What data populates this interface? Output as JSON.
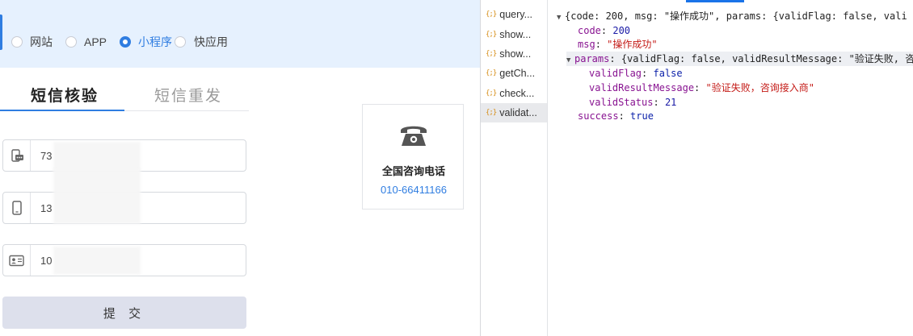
{
  "app": {
    "type_options": [
      {
        "label": "网站",
        "checked": false
      },
      {
        "label": "APP",
        "checked": false
      },
      {
        "label": "小程序",
        "checked": true
      },
      {
        "label": "快应用",
        "checked": false
      }
    ],
    "tabs": [
      {
        "label": "短信核验",
        "active": true
      },
      {
        "label": "短信重发",
        "active": false
      }
    ],
    "fields": {
      "code_value": "73",
      "phone_value": "13",
      "id_value": "10"
    },
    "submit_label": "提 交",
    "consult": {
      "title": "全国咨询电话",
      "phone": "010-66411166"
    }
  },
  "devtools": {
    "requests": [
      {
        "name": "query...",
        "selected": false
      },
      {
        "name": "show...",
        "selected": false
      },
      {
        "name": "show...",
        "selected": false
      },
      {
        "name": "getCh...",
        "selected": false
      },
      {
        "name": "check...",
        "selected": false
      },
      {
        "name": "validat...",
        "selected": true
      }
    ],
    "request_icon": "{;}",
    "preview": {
      "summary": "{code: 200, msg: \"操作成功\", params: {validFlag: false, vali",
      "code_key": "code",
      "code_value": "200",
      "msg_key": "msg",
      "msg_value": "\"操作成功\"",
      "params_key": "params",
      "params_summary": "{validFlag: false, validResultMessage: \"验证失败, 咨",
      "validFlag_key": "validFlag",
      "validFlag_value": "false",
      "validResultMessage_key": "validResultMessage",
      "validResultMessage_value": "\"验证失败，咨询接入商\"",
      "validStatus_key": "validStatus",
      "validStatus_value": "21",
      "success_key": "success",
      "success_value": "true"
    },
    "colors": {
      "accent": "#1a73e8",
      "key": "#881391",
      "string": "#c41a16",
      "number": "#1a1aa6",
      "icon": "#d7901c"
    }
  }
}
